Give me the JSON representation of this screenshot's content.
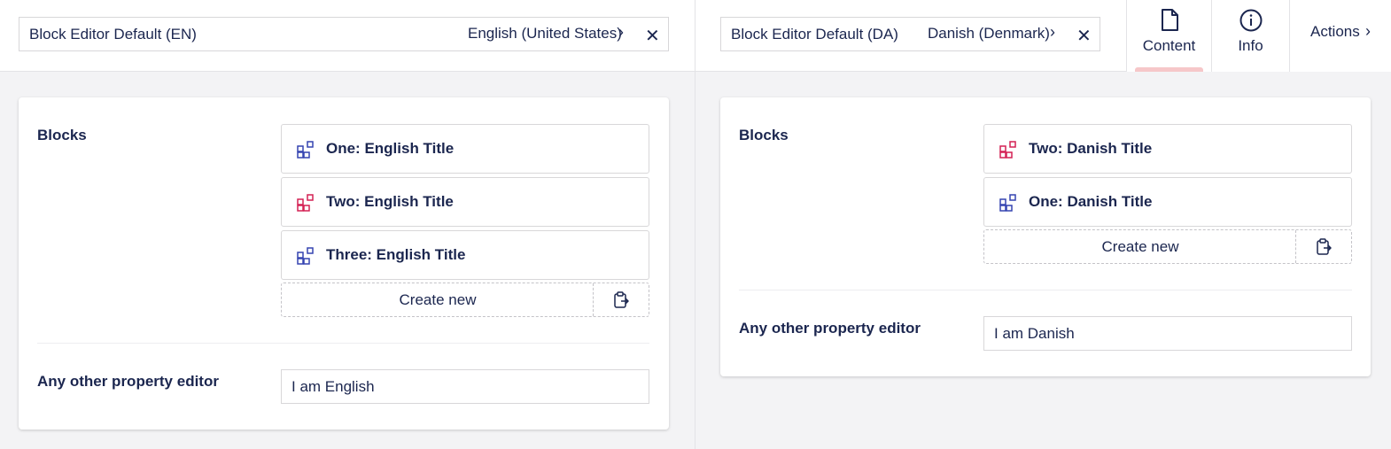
{
  "left": {
    "document_name": "Block Editor Default (EN)",
    "culture": "English (United States)",
    "blocks_label": "Blocks",
    "blocks": [
      {
        "title": "One: English Title",
        "color": "#3544b1"
      },
      {
        "title": "Two: English Title",
        "color": "#d42054"
      },
      {
        "title": "Three: English Title",
        "color": "#3544b1"
      }
    ],
    "create_new": "Create new",
    "other_label": "Any other property editor",
    "other_value": "I am English"
  },
  "right": {
    "document_name": "Block Editor Default (DA)",
    "culture": "Danish (Denmark)",
    "blocks_label": "Blocks",
    "blocks": [
      {
        "title": "Two: Danish Title",
        "color": "#d42054"
      },
      {
        "title": "One: Danish Title",
        "color": "#3544b1"
      }
    ],
    "create_new": "Create new",
    "other_label": "Any other property editor",
    "other_value": "I am Danish"
  },
  "tabs": [
    {
      "label": "Content",
      "icon": "document-icon",
      "active": true
    },
    {
      "label": "Info",
      "icon": "info-icon",
      "active": false
    }
  ],
  "actions_label": "Actions",
  "colors": {
    "text": "#1b264f",
    "blue_block": "#3544b1",
    "pink_block": "#d42054",
    "active_tab": "#f6c7c9"
  }
}
